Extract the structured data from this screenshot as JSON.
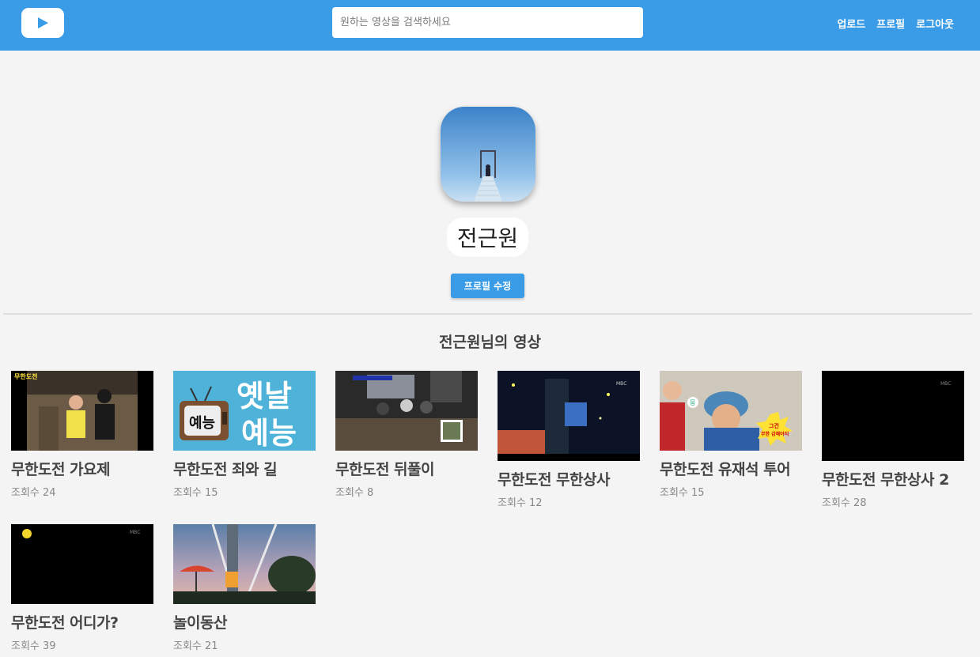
{
  "header": {
    "logo_icon": "play-icon",
    "search_placeholder": "원하는 영상을 검색하세요",
    "nav": [
      "업로드",
      "프로필",
      "로그아웃"
    ]
  },
  "profile": {
    "name": "전근원",
    "edit_label": "프로필 수정"
  },
  "section_title": "전근원님의 영상",
  "videos": [
    {
      "title": "무한도전 가요제",
      "views": "조회수 24"
    },
    {
      "title": "무한도전 죄와 길",
      "views": "조회수 15"
    },
    {
      "title": "무한도전 뒤풀이",
      "views": "조회수 8"
    },
    {
      "title": "무한도전 무한상사",
      "views": "조회수 12"
    },
    {
      "title": "무한도전 유재석 투어",
      "views": "조회수 15"
    },
    {
      "title": "무한도전 무한상사 2",
      "views": "조회수 28"
    },
    {
      "title": "무한도전 어디가?",
      "views": "조회수 39"
    },
    {
      "title": "놀이동산",
      "views": "조회수 21"
    }
  ],
  "thumb_text": {
    "logo_corner": "MBC",
    "v1_logo": "무한도전",
    "v2_line1": "옛날",
    "v2_line2": "예능",
    "v2_tv": "예능",
    "v5_badge": "그건",
    "v5_badge2": "무한 감해야지",
    "v5_sign": "뭉"
  },
  "colors": {
    "primary": "#3a9be6",
    "background": "#f4f4f4"
  }
}
